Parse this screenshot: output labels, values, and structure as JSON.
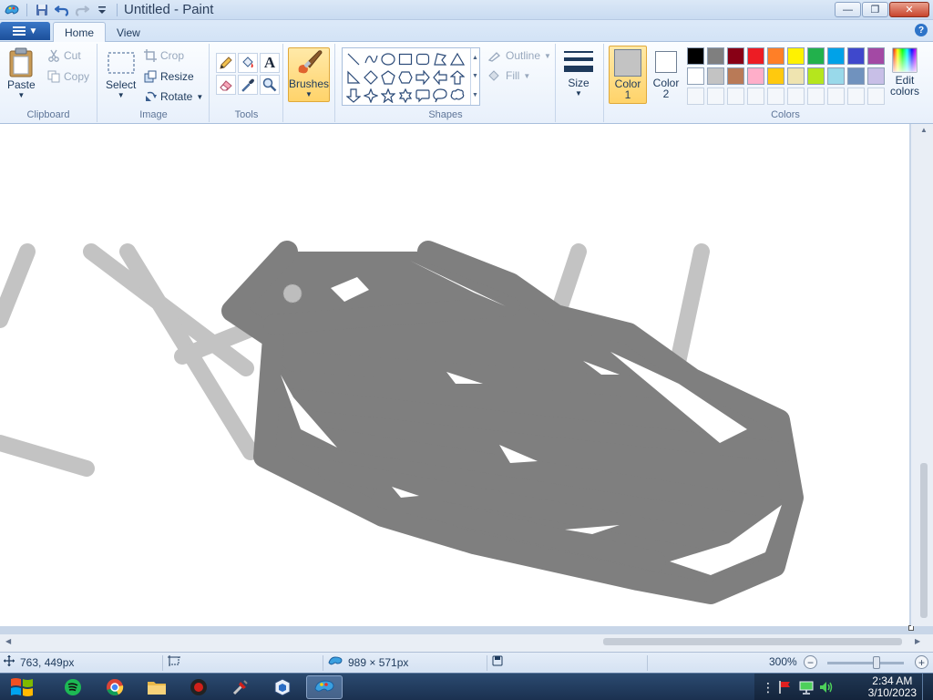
{
  "window": {
    "title": "Untitled - Paint",
    "controls": {
      "minimize": "—",
      "maximize": "❐",
      "close": "✕"
    }
  },
  "tabs": [
    {
      "label": "Home",
      "active": true
    },
    {
      "label": "View",
      "active": false
    }
  ],
  "help": "?",
  "ribbon": {
    "clipboard": {
      "label": "Clipboard",
      "paste": "Paste",
      "cut": "Cut",
      "copy": "Copy"
    },
    "image": {
      "label": "Image",
      "select": "Select",
      "crop": "Crop",
      "resize": "Resize",
      "rotate": "Rotate"
    },
    "tools": {
      "label": "Tools",
      "items": [
        "pencil-icon",
        "fill-icon",
        "text-icon",
        "eraser-icon",
        "color-picker-icon",
        "magnifier-icon"
      ],
      "text_glyph": "A"
    },
    "brushes": {
      "label": "Brushes"
    },
    "shapes": {
      "label": "Shapes",
      "outline": "Outline",
      "fill": "Fill"
    },
    "size": {
      "label": "Size"
    },
    "colors": {
      "label": "Colors",
      "color1": {
        "label_line1": "Color",
        "label_line2": "1",
        "value": "#c3c3c3"
      },
      "color2": {
        "label_line1": "Color",
        "label_line2": "2",
        "value": "#ffffff"
      },
      "edit": {
        "label_line1": "Edit",
        "label_line2": "colors"
      },
      "palette_row1": [
        "#000000",
        "#7f7f7f",
        "#880015",
        "#ed1c24",
        "#ff7f27",
        "#fff200",
        "#22b14c",
        "#00a2e8",
        "#3f48cc",
        "#a349a4"
      ],
      "palette_row2": [
        "#ffffff",
        "#c3c3c3",
        "#b97a57",
        "#ffaec9",
        "#ffc90e",
        "#efe4b0",
        "#b5e61d",
        "#99d9ea",
        "#7092be",
        "#c8bfe7"
      ],
      "custom_slots": 10
    }
  },
  "status": {
    "cursor_position": "763, 449px",
    "selection_size": "",
    "image_size": "989 × 571px",
    "zoom": "300%"
  },
  "taskbar": {
    "apps": [
      "spotify-icon",
      "chrome-icon",
      "file-explorer-icon",
      "media-player-icon",
      "tools-icon",
      "virtualbox-icon",
      "paint-icon"
    ],
    "time": "2:34 AM",
    "date": "3/10/2023"
  }
}
